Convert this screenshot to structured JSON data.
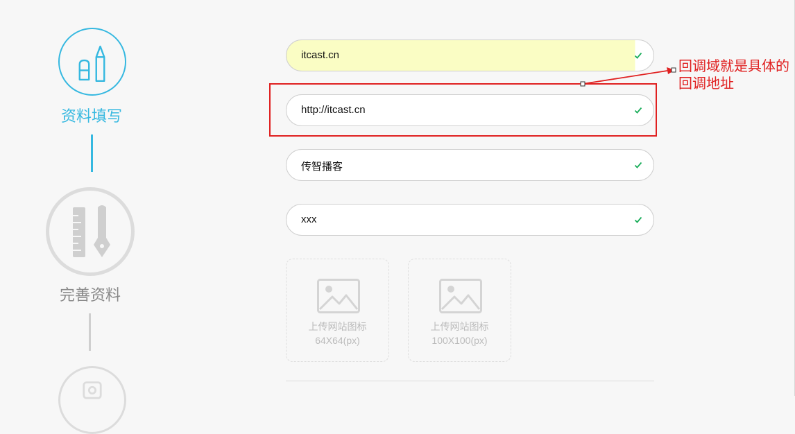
{
  "steps": [
    {
      "label": "资料填写",
      "status": "active",
      "icon": "pen-eraser-icon"
    },
    {
      "label": "完善资料",
      "status": "inactive",
      "icon": "ruler-pen-icon"
    },
    {
      "label": "",
      "status": "inactive",
      "icon": "step-three-icon"
    }
  ],
  "form": {
    "fields": [
      {
        "value": "itcast.cn",
        "valid": true,
        "autofilled": true
      },
      {
        "value": "http://itcast.cn",
        "valid": true
      },
      {
        "value": "传智播客",
        "valid": true
      },
      {
        "value": "xxx",
        "valid": true
      }
    ],
    "uploads": [
      {
        "line1": "上传网站图标",
        "line2": "64X64(px)"
      },
      {
        "line1": "上传网站图标",
        "line2": "100X100(px)"
      }
    ]
  },
  "annotation": {
    "text": "回调域就是具体的回调地址",
    "color": "#e02020"
  },
  "colors": {
    "accent": "#35b8e0",
    "valid": "#1aad5a",
    "inactive": "#dcdcdc"
  }
}
